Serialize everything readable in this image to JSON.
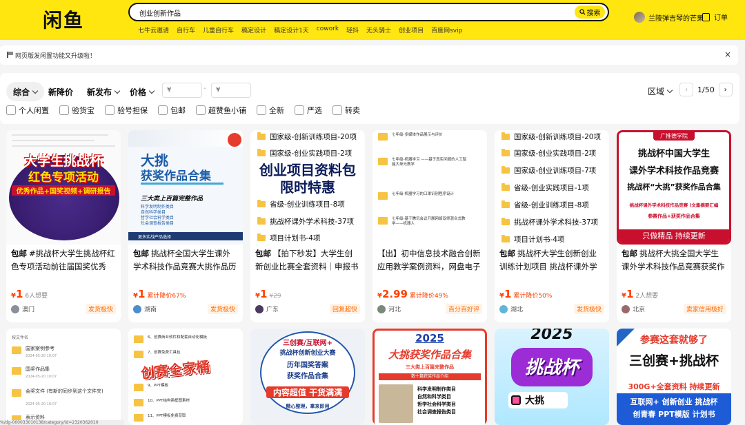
{
  "header": {
    "logo": "闲鱼",
    "search_value": "创业创新作品",
    "search_button": "搜索",
    "hot_words": [
      "七牛云邀请",
      "自行车",
      "儿童自行车",
      "稿定设计",
      "稿定设计1天",
      "cowork",
      "轻抖",
      "无头骑士",
      "创业项目",
      "百度网svip"
    ],
    "username": "兰陵弹吉琴的芒果",
    "orders": "订单",
    "brand_color": "#ffe60f"
  },
  "notice": {
    "text": "网页版发闲置功能又升级啦！",
    "close": "×"
  },
  "filters": {
    "sort": [
      "综合",
      "新降价",
      "新发布",
      "价格"
    ],
    "price_min_placeholder": "¥",
    "price_max_placeholder": "¥",
    "price_dash": "-",
    "region": "区域",
    "page": "1/50",
    "prev": "‹",
    "next": "›",
    "checks": [
      "个人闲置",
      "验货宝",
      "验号担保",
      "包邮",
      "超赞鱼小铺",
      "全新",
      "严选",
      "转卖"
    ]
  },
  "cards": [
    {
      "title_tag": "包邮",
      "title": "#挑战杯大学生挑战杯红色专项活动前往届国奖优秀作...",
      "price_symbol": "¥",
      "price": "1",
      "want": "6人想要",
      "drop": "",
      "original": "",
      "location": "澳门",
      "badge": "发货极快",
      "thumb": {
        "line1": "大学生挑战杯",
        "line2": "红色专项活动",
        "line3": "优秀作品+国奖视频+调研报告"
      }
    },
    {
      "title_tag": "包邮",
      "title": "挑战杯全国大学生课外学术科技作品竞赛大挑作品历年...",
      "price_symbol": "¥",
      "price": "1",
      "want": "",
      "drop": "累计降价67%",
      "original": "",
      "location": "湖南",
      "badge": "发货极快",
      "thumb": {
        "line1": "大挑",
        "line2": "获奖作品合集",
        "line3": "三大类上百篇完整作品",
        "items": [
          "科学发明制作类目",
          "自然科学类目",
          "哲学社会科学类目",
          "社会调查报告类目"
        ],
        "footer": "更多实战产品选择"
      }
    },
    {
      "title_tag": "包邮",
      "title": "【拍下秒发】大学生创新创业比赛全套资料｜申报书+...",
      "price_symbol": "¥",
      "price": "1",
      "want": "",
      "drop": "",
      "original": "¥29",
      "location": "广东",
      "badge": "回复超快",
      "thumb": {
        "top": [
          "国家级-创新训练项目-20项",
          "国家级-创业实践项目-2项"
        ],
        "big1": "创业项目资料包",
        "big2": "限时特惠",
        "bottom": [
          "省级-创业训练项目-8项",
          "挑战杯课外学术科技-37项",
          "项目计划书-4项"
        ]
      }
    },
    {
      "title_tag": "",
      "title": "【出】初中信息技术融合创新应用教学案例资料，网盘电子版...",
      "price_symbol": "¥",
      "price": "2.99",
      "want": "",
      "drop": "累计降价49%",
      "original": "",
      "location": "河北",
      "badge": "百分百好评",
      "thumb": {
        "rows": [
          "七年级-多媒体作品展示与评价",
          "七年级-机器学习 ——基于真实问题的人工智能大单元教学",
          "七年级-机器学习的口罩识别程序设计",
          "七年级-基于腾讯会议开展网络双师混合式教学——机器人"
        ]
      }
    },
    {
      "title_tag": "包邮",
      "title": "挑战杯大学生创新创业训练计划项目 挑战杯课外学术科技作...",
      "price_symbol": "¥",
      "price": "1",
      "want": "",
      "drop": "累计降价50%",
      "original": "",
      "location": "湖北",
      "badge": "发货极快",
      "thumb": {
        "rows": [
          "国家级-创新训练项目-20项",
          "国家级-创业实践项目-2项",
          "国家级-创业训练项目-7项",
          "省级-创业实践项目-1项",
          "省级-创业训练项目-8项",
          "挑战杯课外学术科技-37项",
          "项目计划书-4项"
        ]
      }
    },
    {
      "title_tag": "包邮",
      "title": "挑战杯大挑全国大学生课外学术科技作品竞赛获奖作品...",
      "price_symbol": "¥",
      "price": "1",
      "want": "2人想要",
      "drop": "",
      "original": "",
      "location": "北京",
      "badge": "卖家信用极好",
      "thumb": {
        "ribbon": "广推德学院",
        "line1": "挑战杯中国大学生",
        "line2": "课外学术科技作品竞赛",
        "line3": "挑战杯“大挑”获奖作品合集",
        "line4": "挑战杯课外学术科技作品竞赛 (文集摘要汇编",
        "line5": "参赛作品+获奖作品合集",
        "footer": "只做精品  持续更新"
      }
    }
  ],
  "row2": [
    {
      "thumb": {
        "header": "按文件名",
        "rows": [
          "国家案例参考",
          "国奖作品集",
          "会奖文件 (有新的同步到这个文件夹)",
          "表示资料"
        ],
        "date": "2024-05-20 10:07"
      }
    },
    {
      "thumb": {
        "rows": [
          "6、创赛商业软件和配套自动化模板",
          "7、创赛免费工具包",
          "9、PPT模板",
          "10、PPT结构画框图素材",
          "11、PPT模板免费获取"
        ],
        "big": "创赛全家桶"
      }
    },
    {
      "thumb": {
        "line1": "三创赛/互联网+",
        "line2": "挑战杯创新创业大赛",
        "line3": "历年国奖答案",
        "line4": "获奖作品合集",
        "line5": "内容超值  干货满满",
        "line6": "精心整理，拿来即用"
      }
    },
    {
      "thumb": {
        "year": "2025",
        "line1": "大挑获奖作品合集",
        "line2": "三大类上百篇完整作品",
        "line3": "数十篇获奖作品介绍",
        "items": [
          "科学发明制作类目",
          "自然和科学类目",
          "哲学社会科学类目",
          "社会调查报告类目"
        ]
      }
    },
    {
      "thumb": {
        "year": "2025",
        "big": "挑战杯",
        "tag": "大挑"
      }
    },
    {
      "thumb": {
        "line1": "参赛这套就够了",
        "line2": "三创赛+挑战杯",
        "line3": "300G+全套资料 持续更新",
        "line4": "互联网+  创新创业  挑战杯",
        "line5": "创青春    PPT模版   计划书"
      }
    }
  ],
  "status_url": "%/dg-000033010138/category/id=2320362010"
}
